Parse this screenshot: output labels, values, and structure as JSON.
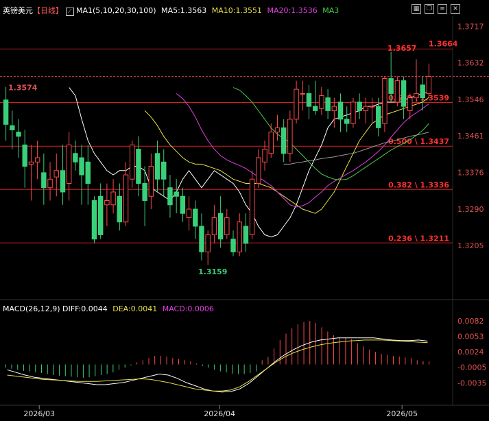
{
  "header": {
    "symbol": "英镑美元",
    "period": "【日线】",
    "ma_label": "MA1(5,10,20,30,100)",
    "ma5": "MA5:1.3563",
    "ma10": "MA10:1.3551",
    "ma20": "MA20:1.3536",
    "ma3": "MA3"
  },
  "macd_header": {
    "label": "MACD(26,12,9)",
    "diff": "DIFF:0.0044",
    "dea": "DEA:0.0041",
    "macd": "MACD:0.0006"
  },
  "colors": {
    "up": "#ff4a4a",
    "down": "#39d07a",
    "ma5": "#ffffff",
    "ma10": "#e8e04a",
    "ma20": "#e040e0",
    "ma30": "#44d044",
    "ma100": "#9a9a9a",
    "fib": "#d42020",
    "macd_diff": "#ffffff",
    "macd_dea": "#e8e04a"
  },
  "chart_data": [
    {
      "type": "candlestick",
      "y_ticks": [
        "1.3717",
        "1.3632",
        "1.3546",
        "1.3461",
        "1.3376",
        "1.3290",
        "1.3205"
      ],
      "x_ticks": [
        "2026/03",
        "2026/04",
        "2026/05"
      ],
      "ylim": [
        1.3125,
        1.374
      ],
      "annotations": {
        "high": "1.3657",
        "low": "1.3159",
        "left_label": "1.3574",
        "top_right": "1.3664"
      },
      "fib_levels": [
        {
          "label": "0.618 \\ 1.3539",
          "value": 1.3539
        },
        {
          "label": "0.500 \\ 1.3437",
          "value": 1.3437
        },
        {
          "label": "0.382 \\ 1.3336",
          "value": 1.3336
        },
        {
          "label": "0.236 \\ 1.3211",
          "value": 1.3211
        }
      ],
      "top_line": 1.3664,
      "last_price_line": 1.36,
      "candles": [
        [
          1.3545,
          1.3488,
          1.3575,
          1.345
        ],
        [
          1.3485,
          1.3475,
          1.352,
          1.343
        ],
        [
          1.347,
          1.346,
          1.35,
          1.341
        ],
        [
          1.344,
          1.339,
          1.3475,
          1.334
        ],
        [
          1.3395,
          1.34,
          1.344,
          1.331
        ],
        [
          1.34,
          1.341,
          1.345,
          1.336
        ],
        [
          1.3375,
          1.334,
          1.342,
          1.33
        ],
        [
          1.334,
          1.336,
          1.34,
          1.331
        ],
        [
          1.3365,
          1.338,
          1.342,
          1.332
        ],
        [
          1.338,
          1.333,
          1.344,
          1.33
        ],
        [
          1.335,
          1.344,
          1.347,
          1.331
        ],
        [
          1.342,
          1.34,
          1.345,
          1.338
        ],
        [
          1.341,
          1.337,
          1.344,
          1.33
        ],
        [
          1.34,
          1.335,
          1.344,
          1.33
        ],
        [
          1.331,
          1.322,
          1.332,
          1.321
        ],
        [
          1.332,
          1.323,
          1.335,
          1.322
        ],
        [
          1.33,
          1.331,
          1.335,
          1.325
        ],
        [
          1.33,
          1.333,
          1.336,
          1.328
        ],
        [
          1.332,
          1.326,
          1.335,
          1.324
        ],
        [
          1.326,
          1.337,
          1.34,
          1.325
        ],
        [
          1.336,
          1.344,
          1.345,
          1.334
        ],
        [
          1.343,
          1.335,
          1.346,
          1.332
        ],
        [
          1.335,
          1.331,
          1.339,
          1.325
        ],
        [
          1.332,
          1.339,
          1.342,
          1.329
        ],
        [
          1.342,
          1.336,
          1.345,
          1.333
        ],
        [
          1.34,
          1.336,
          1.343,
          1.332
        ],
        [
          1.334,
          1.33,
          1.337,
          1.327
        ],
        [
          1.333,
          1.332,
          1.336,
          1.328
        ],
        [
          1.332,
          1.328,
          1.334,
          1.326
        ],
        [
          1.327,
          1.329,
          1.332,
          1.324
        ],
        [
          1.329,
          1.325,
          1.331,
          1.322
        ],
        [
          1.325,
          1.319,
          1.328,
          1.317
        ],
        [
          1.319,
          1.323,
          1.324,
          1.3159
        ],
        [
          1.323,
          1.327,
          1.33,
          1.321
        ],
        [
          1.328,
          1.322,
          1.332,
          1.32
        ],
        [
          1.323,
          1.327,
          1.329,
          1.322
        ],
        [
          1.322,
          1.319,
          1.324,
          1.318
        ],
        [
          1.319,
          1.326,
          1.328,
          1.318
        ],
        [
          1.325,
          1.321,
          1.328,
          1.319
        ],
        [
          1.323,
          1.336,
          1.338,
          1.322
        ],
        [
          1.335,
          1.341,
          1.343,
          1.334
        ],
        [
          1.34,
          1.343,
          1.345,
          1.338
        ],
        [
          1.342,
          1.347,
          1.349,
          1.341
        ],
        [
          1.347,
          1.348,
          1.351,
          1.345
        ],
        [
          1.348,
          1.342,
          1.35,
          1.34
        ],
        [
          1.342,
          1.35,
          1.352,
          1.34
        ],
        [
          1.35,
          1.357,
          1.359,
          1.349
        ],
        [
          1.356,
          1.356,
          1.359,
          1.352
        ],
        [
          1.356,
          1.353,
          1.358,
          1.35
        ],
        [
          1.353,
          1.352,
          1.359,
          1.351
        ],
        [
          1.3525,
          1.3555,
          1.3575,
          1.351
        ],
        [
          1.355,
          1.352,
          1.357,
          1.35
        ],
        [
          1.352,
          1.353,
          1.355,
          1.348
        ],
        [
          1.354,
          1.35,
          1.356,
          1.347
        ],
        [
          1.35,
          1.349,
          1.353,
          1.347
        ],
        [
          1.349,
          1.354,
          1.355,
          1.348
        ],
        [
          1.354,
          1.352,
          1.356,
          1.35
        ],
        [
          1.352,
          1.353,
          1.355,
          1.349
        ],
        [
          1.353,
          1.353,
          1.355,
          1.349
        ],
        [
          1.353,
          1.348,
          1.355,
          1.346
        ],
        [
          1.349,
          1.3595,
          1.36,
          1.347
        ],
        [
          1.3595,
          1.356,
          1.3657,
          1.354
        ],
        [
          1.354,
          1.359,
          1.36,
          1.353
        ],
        [
          1.359,
          1.353,
          1.36,
          1.35
        ],
        [
          1.352,
          1.355,
          1.356,
          1.35
        ],
        [
          1.355,
          1.356,
          1.364,
          1.354
        ],
        [
          1.358,
          1.355,
          1.36,
          1.352
        ],
        [
          1.356,
          1.36,
          1.363,
          1.355
        ]
      ],
      "ma_series": [
        {
          "key": "ma5",
          "values": [
            1.3574,
            1.3555,
            1.35,
            1.345,
            1.342,
            1.34,
            1.338,
            1.337,
            1.338,
            1.338,
            1.339,
            1.339,
            1.338,
            1.334,
            1.333,
            1.332,
            1.331,
            1.333,
            1.336,
            1.338,
            1.336,
            1.334,
            1.336,
            1.338,
            1.337,
            1.336,
            1.335,
            1.333,
            1.33,
            1.328,
            1.325,
            1.323,
            1.3225,
            1.323,
            1.325,
            1.327,
            1.33,
            1.334,
            1.338,
            1.341,
            1.344,
            1.348,
            1.35,
            1.3505,
            1.351,
            1.3515,
            1.352,
            1.353,
            1.353,
            1.3535,
            1.354,
            1.354,
            1.354,
            1.3545,
            1.355,
            1.3555,
            1.356,
            1.3563
          ]
        },
        {
          "key": "ma10",
          "values": [
            1.352,
            1.3505,
            1.3485,
            1.346,
            1.344,
            1.3425,
            1.341,
            1.34,
            1.3395,
            1.3395,
            1.339,
            1.3385,
            1.338,
            1.337,
            1.336,
            1.3355,
            1.335,
            1.335,
            1.335,
            1.3345,
            1.334,
            1.333,
            1.332,
            1.331,
            1.33,
            1.329,
            1.3285,
            1.328,
            1.329,
            1.331,
            1.333,
            1.336,
            1.339,
            1.342,
            1.345,
            1.347,
            1.349,
            1.35,
            1.351,
            1.3515,
            1.352,
            1.3525,
            1.353,
            1.3535,
            1.354,
            1.3551
          ]
        },
        {
          "key": "ma20",
          "values": [
            1.356,
            1.3548,
            1.353,
            1.3505,
            1.3475,
            1.345,
            1.343,
            1.3415,
            1.3405,
            1.3398,
            1.3392,
            1.3385,
            1.3375,
            1.3365,
            1.3355,
            1.3345,
            1.333,
            1.3315,
            1.33,
            1.3295,
            1.3298,
            1.3305,
            1.3318,
            1.333,
            1.3345,
            1.3355,
            1.3363,
            1.3372,
            1.338,
            1.339,
            1.34,
            1.3412,
            1.3425,
            1.344,
            1.3458,
            1.3475,
            1.3492,
            1.3505,
            1.3515,
            1.3525,
            1.3536
          ]
        },
        {
          "key": "ma30",
          "values": [
            1.3574,
            1.3568,
            1.3555,
            1.354,
            1.352,
            1.35,
            1.348,
            1.3465,
            1.3455,
            1.3445,
            1.343,
            1.3415,
            1.34,
            1.3385,
            1.3372,
            1.3365,
            1.336,
            1.3358,
            1.336,
            1.3368,
            1.3378,
            1.3388,
            1.3398,
            1.3408,
            1.3418,
            1.3428,
            1.3436,
            1.3444,
            1.3452,
            1.3462,
            1.3474,
            1.349
          ]
        },
        {
          "key": "ma100",
          "values": [
            1.3395,
            1.3395,
            1.3398,
            1.34,
            1.3403,
            1.3405,
            1.3408,
            1.341,
            1.3412,
            1.3415,
            1.3418,
            1.342,
            1.3425,
            1.343,
            1.3435,
            1.344,
            1.3445,
            1.3448,
            1.3452,
            1.3456,
            1.346,
            1.3463,
            1.3466,
            1.347
          ]
        }
      ]
    },
    {
      "type": "macd",
      "y_ticks": [
        "0.0082",
        "0.0053",
        "0.0024",
        "-0.0005",
        "-0.0035"
      ],
      "ylim": [
        -0.006,
        0.0095
      ],
      "histogram": [
        -0.0006,
        -0.0008,
        -0.001,
        -0.0012,
        -0.0013,
        -0.0015,
        -0.0016,
        -0.0018,
        -0.002,
        -0.0021,
        -0.0022,
        -0.0023,
        -0.0024,
        -0.0025,
        -0.0024,
        -0.0022,
        -0.002,
        -0.0018,
        -0.0015,
        -0.001,
        -0.0006,
        -0.0002,
        0.0004,
        0.0008,
        0.0012,
        0.0016,
        0.0016,
        0.0015,
        0.0012,
        0.001,
        0.0008,
        0.0006,
        0.0002,
        -0.0003,
        -0.0006,
        -0.001,
        -0.0013,
        -0.0015,
        -0.0017,
        -0.0018,
        -0.0018,
        -0.0016,
        -0.0013,
        0.0008,
        0.0014,
        0.003,
        0.0046,
        0.0058,
        0.0068,
        0.0076,
        0.008,
        0.0082,
        0.0078,
        0.007,
        0.0062,
        0.0055,
        0.005,
        0.005,
        0.0048,
        0.004,
        0.0034,
        0.0028,
        0.0024,
        0.002,
        0.0018,
        0.0016,
        0.0015,
        0.0013,
        0.0012,
        0.0008,
        0.0006,
        0.0006
      ],
      "diff": [
        -0.001,
        -0.0015,
        -0.002,
        -0.0024,
        -0.0026,
        -0.0028,
        -0.003,
        -0.0032,
        -0.0034,
        -0.0036,
        -0.0038,
        -0.0038,
        -0.0036,
        -0.0034,
        -0.003,
        -0.0026,
        -0.0022,
        -0.0018,
        -0.002,
        -0.0026,
        -0.0034,
        -0.004,
        -0.0046,
        -0.005,
        -0.0052,
        -0.0051,
        -0.0046,
        -0.0036,
        -0.0022,
        -0.0008,
        0.0006,
        0.0018,
        0.0028,
        0.0036,
        0.0042,
        0.0046,
        0.0048,
        0.005,
        0.005,
        0.005,
        0.005,
        0.005,
        0.0048,
        0.0046,
        0.0045,
        0.0045,
        0.0046,
        0.0044
      ],
      "dea": [
        -0.002,
        -0.0022,
        -0.0024,
        -0.0026,
        -0.0028,
        -0.0029,
        -0.003,
        -0.0031,
        -0.0032,
        -0.0032,
        -0.0032,
        -0.0031,
        -0.003,
        -0.0029,
        -0.0028,
        -0.0027,
        -0.0028,
        -0.0031,
        -0.0034,
        -0.0038,
        -0.0042,
        -0.0046,
        -0.0048,
        -0.005,
        -0.005,
        -0.0048,
        -0.0042,
        -0.0032,
        -0.002,
        -0.0008,
        0.0004,
        0.0014,
        0.0022,
        0.0028,
        0.0033,
        0.0037,
        0.004,
        0.0042,
        0.0044,
        0.0045,
        0.0046,
        0.0046,
        0.0046,
        0.0045,
        0.0044,
        0.0043,
        0.0042,
        0.0041
      ]
    }
  ]
}
